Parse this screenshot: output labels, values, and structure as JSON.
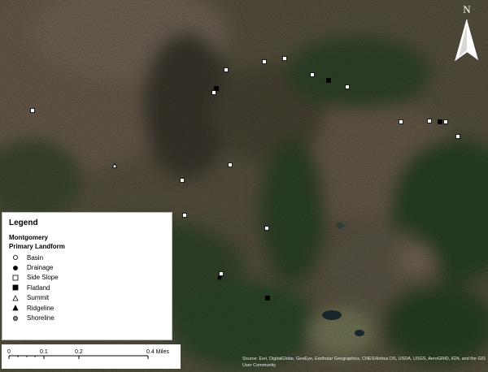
{
  "legend": {
    "title": "Legend",
    "layer_name": "Montgomery",
    "field_name": "Primary Landform",
    "items": [
      {
        "label": "Basin",
        "symbol": "circle-open"
      },
      {
        "label": "Drainage",
        "symbol": "circle-filled"
      },
      {
        "label": "Side Slope",
        "symbol": "square-open"
      },
      {
        "label": "Flatland",
        "symbol": "square-filled"
      },
      {
        "label": "Summit",
        "symbol": "triangle-open"
      },
      {
        "label": "Ridgeline",
        "symbol": "triangle-filled"
      },
      {
        "label": "Shoreline",
        "symbol": "circle-gray"
      }
    ]
  },
  "scale_bar": {
    "ticks": [
      "0",
      "0.1",
      "0.2",
      "0.4 Miles"
    ]
  },
  "north_arrow": {
    "label": "N",
    "icon": "north-arrow-icon"
  },
  "attribution": "Source: Esri, DigitalGlobe, GeoEye, Earthstar Geographics, CNES/Airbus DS, USDA, USGS, AeroGRID, IGN, and the GIS User Community",
  "colors": {
    "legend_bg": "#ffffff",
    "marker_fill": "#ffffff",
    "marker_stroke": "#000000",
    "forest": "#2f4a2a",
    "open_land": "#6e6250"
  }
}
